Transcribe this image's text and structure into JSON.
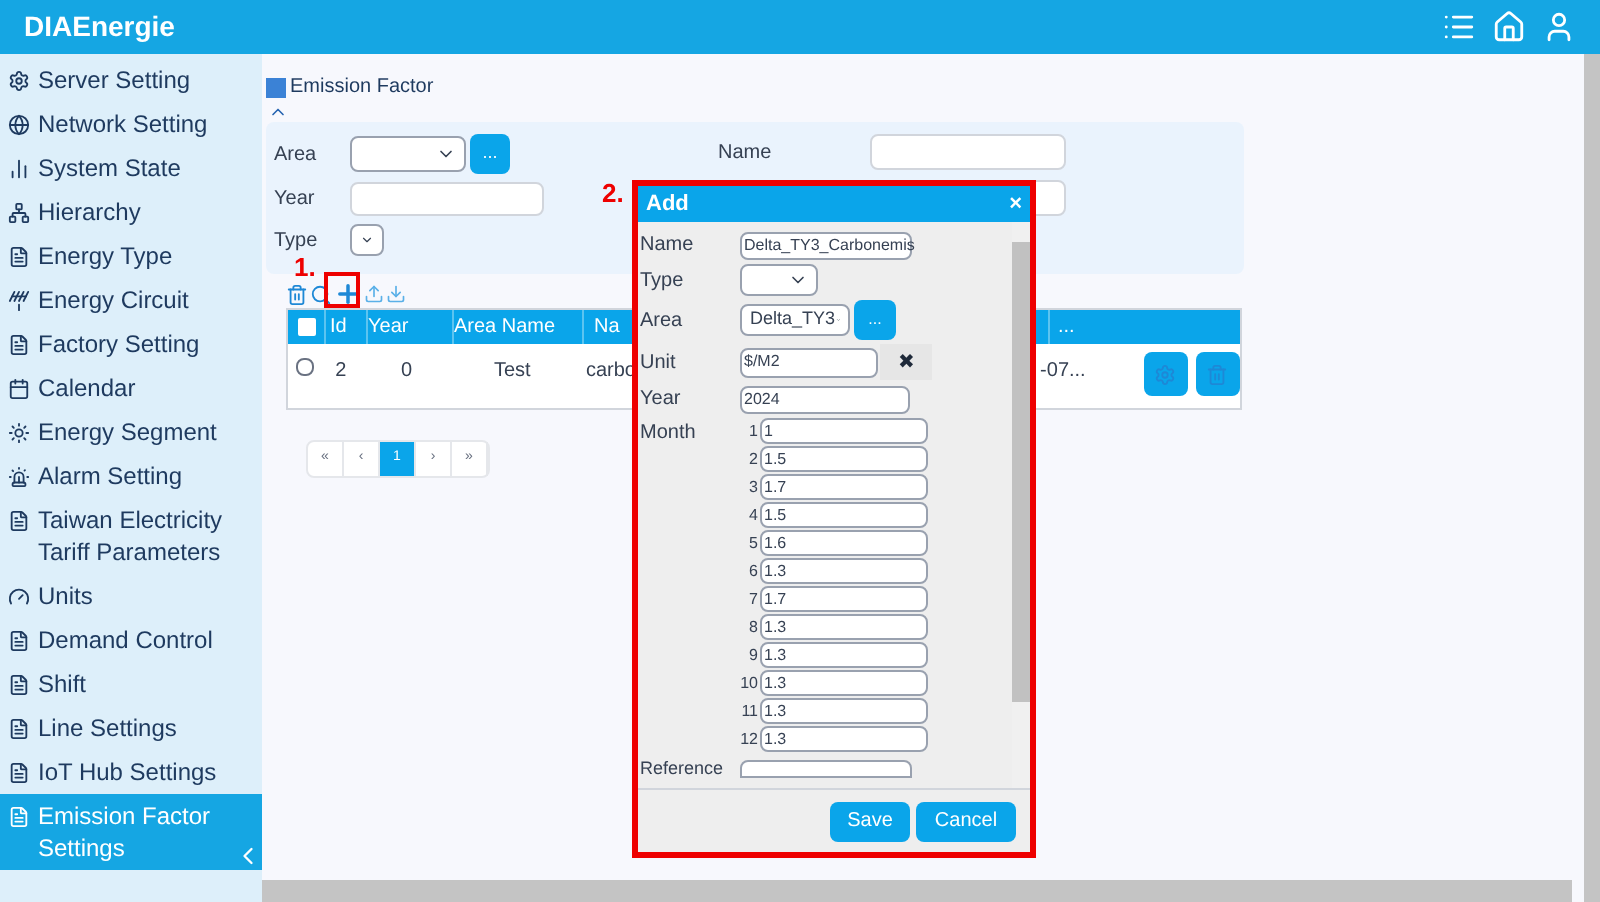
{
  "app": {
    "title": "DIAEnergie"
  },
  "sidebar": {
    "items": [
      {
        "label": "Server Setting",
        "selected": false
      },
      {
        "label": "Network Setting",
        "selected": false
      },
      {
        "label": "System State",
        "selected": false
      },
      {
        "label": "Hierarchy",
        "selected": false
      },
      {
        "label": "Energy Type",
        "selected": false
      },
      {
        "label": "Energy Circuit",
        "selected": false
      },
      {
        "label": "Factory Setting",
        "selected": false
      },
      {
        "label": "Calendar",
        "selected": false
      },
      {
        "label": "Energy Segment",
        "selected": false
      },
      {
        "label": "Alarm Setting",
        "selected": false
      },
      {
        "label": "Taiwan Electricity Tariff Parameters",
        "selected": false
      },
      {
        "label": "Units",
        "selected": false
      },
      {
        "label": "Demand Control",
        "selected": false
      },
      {
        "label": "Shift",
        "selected": false
      },
      {
        "label": "Line Settings",
        "selected": false
      },
      {
        "label": "IoT Hub Settings",
        "selected": false
      },
      {
        "label": "Emission Factor Settings",
        "selected": true
      }
    ]
  },
  "page": {
    "title": "Emission Factor"
  },
  "filter": {
    "area_label": "Area",
    "area_button": "...",
    "year_label": "Year",
    "type_label": "Type",
    "name_label": "Name"
  },
  "annotations": [
    "1.",
    "2."
  ],
  "table": {
    "select_all_checked": false,
    "columns": [
      "Id",
      "Year",
      "Area Name",
      "Na",
      "..."
    ],
    "rows": [
      {
        "checked": false,
        "cells": [
          "2",
          "0",
          "Test",
          "carbo",
          "-07..."
        ]
      }
    ]
  },
  "pagination": [
    {
      "label": "«",
      "selected": false
    },
    {
      "label": "‹",
      "selected": false
    },
    {
      "label": "1",
      "selected": true
    },
    {
      "label": "›",
      "selected": false
    },
    {
      "label": "»",
      "selected": false
    }
  ],
  "dialog": {
    "title": "Add",
    "close": "×",
    "name": {
      "label": "Name",
      "value": "Delta_TY3_Carbonemis"
    },
    "type": {
      "label": "Type"
    },
    "area": {
      "label": "Area",
      "value": "Delta_TY3",
      "button": "..."
    },
    "unit": {
      "label": "Unit",
      "value": "$/M2",
      "clear": "✖"
    },
    "year": {
      "label": "Year",
      "value": "2024"
    },
    "month": {
      "label": "Month",
      "values": [
        {
          "index": "1",
          "value": "1"
        },
        {
          "index": "2",
          "value": "1.5"
        },
        {
          "index": "3",
          "value": "1.7"
        },
        {
          "index": "4",
          "value": "1.5"
        },
        {
          "index": "5",
          "value": "1.6"
        },
        {
          "index": "6",
          "value": "1.3"
        },
        {
          "index": "7",
          "value": "1.7"
        },
        {
          "index": "8",
          "value": "1.3"
        },
        {
          "index": "9",
          "value": "1.3"
        },
        {
          "index": "10",
          "value": "1.3"
        },
        {
          "index": "11",
          "value": "1.3"
        },
        {
          "index": "12",
          "value": "1.3"
        }
      ]
    },
    "reference": {
      "label": "Reference"
    },
    "buttons": [
      "Save",
      "Cancel"
    ]
  }
}
